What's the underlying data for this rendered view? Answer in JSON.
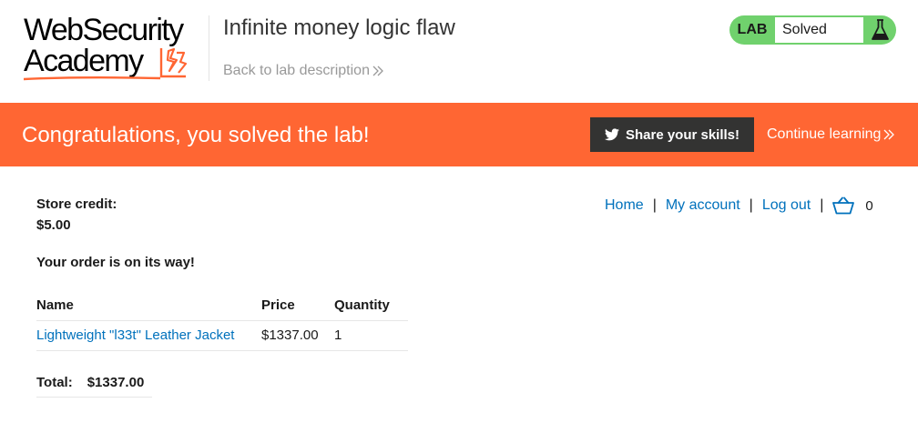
{
  "header": {
    "logo_line1": "WebSecurity",
    "logo_line2": "Academy",
    "lab_title": "Infinite money logic flaw",
    "back_link": "Back to lab description",
    "lab_badge": "LAB",
    "lab_status": "Solved"
  },
  "banner": {
    "message": "Congratulations, you solved the lab!",
    "share_label": "Share your skills!",
    "continue_label": "Continue learning"
  },
  "nav": {
    "home": "Home",
    "account": "My account",
    "logout": "Log out",
    "separator": "|",
    "cart_count": "0"
  },
  "store": {
    "credit_label": "Store credit:",
    "credit_value": "$5.00",
    "order_message": "Your order is on its way!"
  },
  "order_table": {
    "headers": [
      "Name",
      "Price",
      "Quantity"
    ],
    "rows": [
      {
        "name": "Lightweight \"l33t\" Leather Jacket",
        "price": "$1337.00",
        "quantity": "1"
      }
    ],
    "total_label": "Total:",
    "total_value": "$1337.00"
  },
  "colors": {
    "accent_orange": "#ff6633",
    "lab_green": "#70d16d",
    "link_blue": "#0071bc",
    "share_button_bg": "#333332"
  },
  "icons": {
    "logo_mark": "academy-bolt-icon",
    "flask": "flask-icon",
    "twitter": "twitter-icon",
    "cart": "cart-icon",
    "chevrons": "double-chevron-right-icon"
  }
}
